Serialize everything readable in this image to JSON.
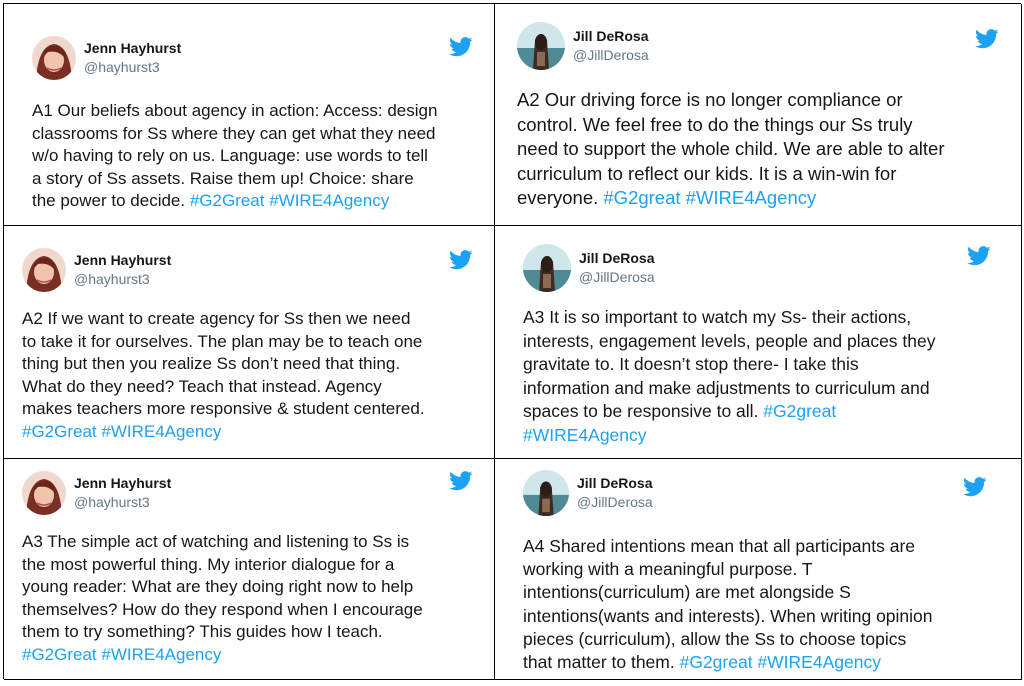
{
  "colors": {
    "text": "#14171a",
    "handle": "#657786",
    "hashtag": "#1da1f2",
    "twitter": "#1da1f2"
  },
  "tweets": [
    {
      "author": "Jenn Hayhurst",
      "handle": "@hayhurst3",
      "lines": [
        "A1 Our beliefs about agency in action: Access: design",
        "classrooms for Ss where they can get what they need",
        "w/o having to rely on us. Language: use words to tell",
        "a story of Ss assets.  Raise them up! Choice: share",
        "the power to decide. "
      ],
      "tags": "#G2Great #WIRE4Agency"
    },
    {
      "author": "Jill DeRosa",
      "handle": "@JillDerosa",
      "lines": [
        "A2 Our driving force is no longer compliance or",
        "control. We feel free to do the things our Ss truly",
        "need to support the whole child. We are able to alter",
        "curriculum to reflect our kids.  It is a win-win for",
        "everyone. "
      ],
      "tags": "#G2great #WIRE4Agency"
    },
    {
      "author": "Jenn Hayhurst",
      "handle": "@hayhurst3",
      "lines": [
        "A2 If we want to create agency for Ss then we need",
        "to take it for ourselves. The plan may be to teach one",
        "thing but then you realize Ss don’t need that thing.",
        "What do they need? Teach that instead. Agency",
        "makes teachers more responsive & student centered.",
        ""
      ],
      "tags": "#G2Great #WIRE4Agency"
    },
    {
      "author": "Jill DeRosa",
      "handle": "@JillDerosa",
      "lines": [
        "A3 It is so important  to watch my Ss- their actions,",
        "interests, engagement levels, people and places they",
        "gravitate to. It doesn’t stop there- I take this",
        "information and make adjustments to curriculum and",
        "spaces to be responsive to all. "
      ],
      "tags": "#G2great",
      "tags2": "#WIRE4Agency"
    },
    {
      "author": "Jenn Hayhurst",
      "handle": "@hayhurst3",
      "lines": [
        "A3 The simple act of watching and listening to Ss is",
        "the most powerful thing. My interior dialogue for a",
        "young reader: What are they doing right now to help",
        "themselves? How do they respond when I encourage",
        "them to try something? This guides how I teach.",
        ""
      ],
      "tags": "#G2Great #WIRE4Agency"
    },
    {
      "author": "Jill DeRosa",
      "handle": "@JillDerosa",
      "lines": [
        "A4 Shared intentions mean that all participants are",
        "working with a meaningful purpose. T",
        "intentions(curriculum)  are met alongside S",
        "intentions(wants and interests). When writing opinion",
        "pieces (curriculum), allow the Ss to choose topics",
        "that matter to them. "
      ],
      "tags": "#G2great #WIRE4Agency"
    }
  ]
}
